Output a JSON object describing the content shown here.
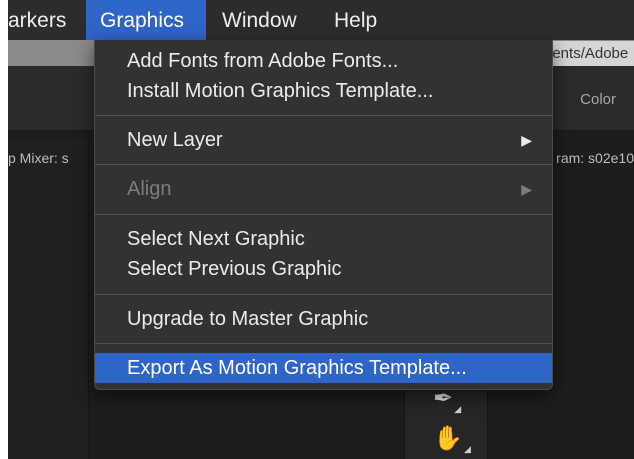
{
  "menubar": {
    "items": [
      {
        "label": "arkers"
      },
      {
        "label": "Graphics"
      },
      {
        "label": "Window"
      },
      {
        "label": "Help"
      }
    ]
  },
  "background": {
    "path_chip": "nents/Adobe",
    "color_tab": "Color",
    "left_label": "p Mixer: s",
    "right_label": "ram: s02e10"
  },
  "graphics_menu": {
    "items": [
      {
        "label": "Add Fonts from Adobe Fonts..."
      },
      {
        "label": "Install Motion Graphics Template..."
      },
      {
        "label": "New Layer",
        "submenu_arrow": "▶"
      },
      {
        "label": "Align",
        "submenu_arrow": "▶",
        "disabled": true
      },
      {
        "label": "Select Next Graphic"
      },
      {
        "label": "Select Previous Graphic"
      },
      {
        "label": "Upgrade to Master Graphic"
      },
      {
        "label": "Export As Motion Graphics Template...",
        "highlighted": true
      }
    ]
  },
  "tools": {
    "pen_icon": "✒",
    "hand_icon": "✋"
  },
  "colors": {
    "highlight": "#2f64c9",
    "menu_bg": "#323232",
    "menubar_bg": "#2c2c2c"
  }
}
